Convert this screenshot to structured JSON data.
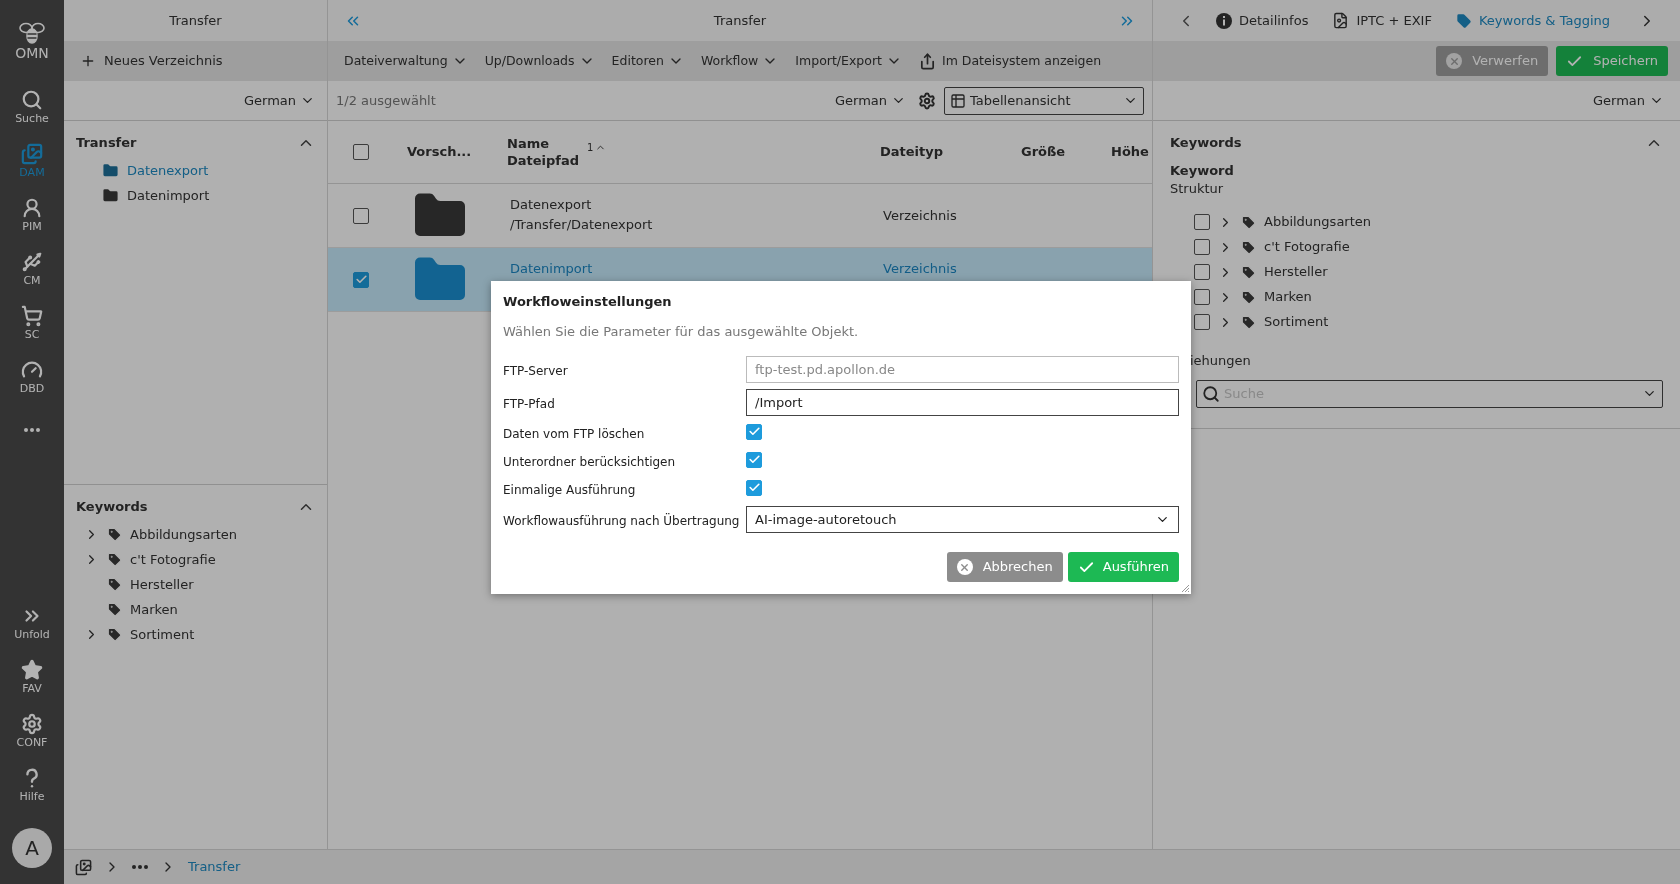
{
  "sidebar": {
    "logo": "OMN",
    "items": [
      {
        "label": "Suche",
        "selected": false
      },
      {
        "label": "DAM",
        "selected": true
      },
      {
        "label": "PIM",
        "selected": false
      },
      {
        "label": "CM",
        "selected": false
      },
      {
        "label": "SC",
        "selected": false
      },
      {
        "label": "DBD",
        "selected": false
      }
    ],
    "bottom_items": [
      {
        "label": "Unfold"
      },
      {
        "label": "FAV"
      },
      {
        "label": "CONF"
      },
      {
        "label": "Hilfe"
      }
    ],
    "avatar": "A"
  },
  "left_panel": {
    "title": "Transfer",
    "new_button": "Neues Verzeichnis",
    "language": "German",
    "tree": {
      "title": "Transfer",
      "expanded": true,
      "items": [
        {
          "label": "Datenexport",
          "selected": true
        },
        {
          "label": "Datenimport",
          "selected": false
        }
      ]
    },
    "keywords": {
      "title": "Keywords",
      "expanded": true,
      "items": [
        {
          "label": "Abbildungsarten",
          "has_children": true
        },
        {
          "label": "c't Fotografie",
          "has_children": true
        },
        {
          "label": "Hersteller",
          "has_children": false
        },
        {
          "label": "Marken",
          "has_children": false
        },
        {
          "label": "Sortiment",
          "has_children": true
        }
      ]
    }
  },
  "center": {
    "title": "Transfer",
    "menus": [
      "Dateiverwaltung",
      "Up/Downloads",
      "Editoren",
      "Workflow",
      "Import/Export"
    ],
    "show_in_filesystem": "Im Dateisystem anzeigen",
    "selection_count": "1/2 ausgewählt",
    "language": "German",
    "view": "Tabellenansicht",
    "table": {
      "header_checked": false,
      "columns": [
        {
          "label": "Vorsch..."
        },
        {
          "label": "Name",
          "sublabel": "Dateipfad",
          "sort_rank": "1"
        },
        {
          "label": "Dateityp"
        },
        {
          "label": "Größe"
        },
        {
          "label": "Höhe"
        }
      ],
      "rows": [
        {
          "name": "Datenexport",
          "path": "/Transfer/Datenexport",
          "type": "Verzeichnis",
          "selected": false
        },
        {
          "name": "Datenimport",
          "type": "Verzeichnis",
          "selected": true
        }
      ]
    }
  },
  "right_panel": {
    "tabs": [
      {
        "label": "Detailinfos",
        "selected": false
      },
      {
        "label": "IPTC + EXIF",
        "selected": false
      },
      {
        "label": "Keywords & Tagging",
        "selected": true
      }
    ],
    "discard_button": "Verwerfen",
    "save_button": "Speichern",
    "language": "German",
    "section_title": "Keywords",
    "section_expanded": true,
    "field_label": "Keyword",
    "field_sublabel": "Struktur",
    "items": [
      {
        "label": "Abbildungsarten",
        "checked": false
      },
      {
        "label": "c't Fotografie",
        "checked": false
      },
      {
        "label": "Hersteller",
        "checked": false
      },
      {
        "label": "Marken",
        "checked": false
      },
      {
        "label": "Sortiment",
        "checked": false
      }
    ],
    "relations_label": "iehungen",
    "search_placeholder": "Suche"
  },
  "breadcrumb": {
    "current": "Transfer"
  },
  "dialog": {
    "title": "Workfloweinstellungen",
    "description": "Wählen Sie die Parameter für das ausgewählte Objekt.",
    "fields": [
      {
        "kind": "text",
        "label": "FTP-Server",
        "placeholder": "ftp-test.pd.apollon.de"
      },
      {
        "kind": "text",
        "label": "FTP-Pfad",
        "value": "/Import"
      },
      {
        "kind": "checkbox",
        "label": "Daten vom FTP löschen",
        "checked": true
      },
      {
        "kind": "checkbox",
        "label": "Unterordner berücksichtigen",
        "checked": true
      },
      {
        "kind": "checkbox",
        "label": "Einmalige Ausführung",
        "checked": true
      },
      {
        "kind": "select",
        "label": "Workflowausführung nach Übertragung",
        "value": "AI-image-autoretouch"
      }
    ],
    "cancel_button": "Abbrechen",
    "run_button": "Ausführen"
  }
}
